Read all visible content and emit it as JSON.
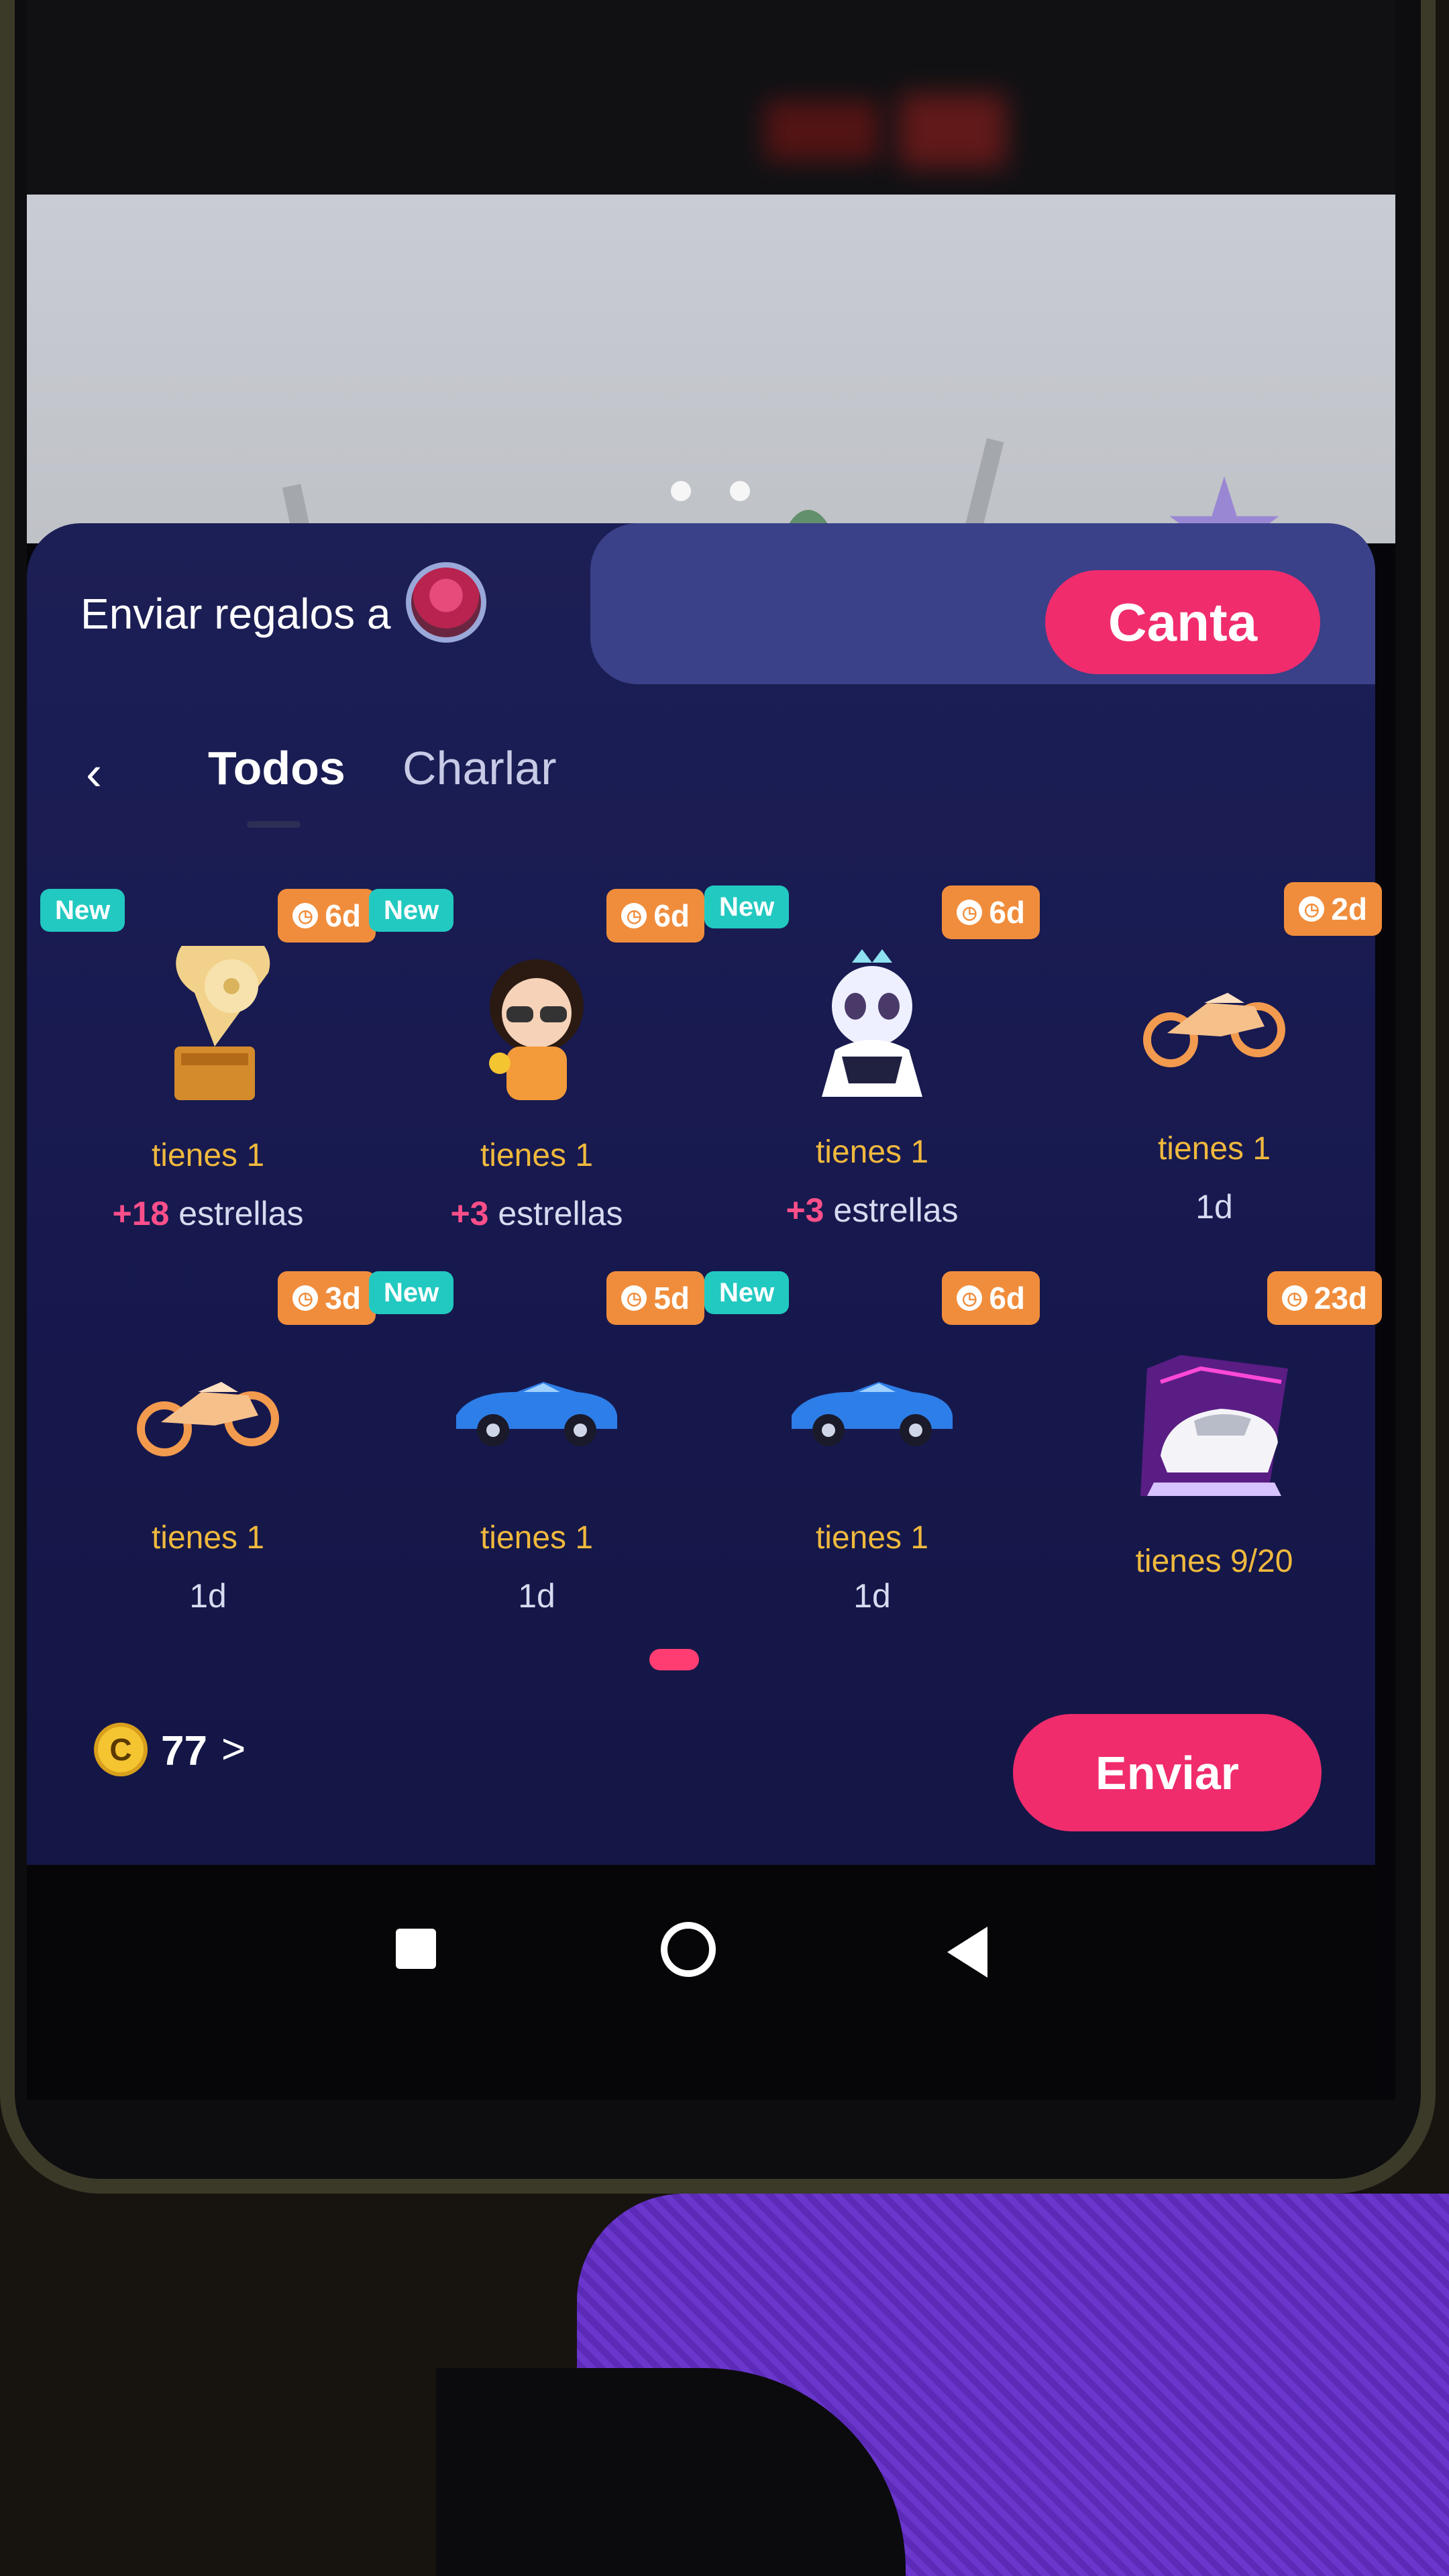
{
  "header": {
    "send_to_label": "Enviar regalos a",
    "canta_button": "Canta"
  },
  "tabs": [
    {
      "label": "Todos",
      "active": true
    },
    {
      "label": "Charlar",
      "active": false
    }
  ],
  "gifts": [
    {
      "name": "gramophone-gift",
      "new": true,
      "time": "6d",
      "owned": "tienes 1",
      "stars_value": "+18",
      "stars_text": " estrellas"
    },
    {
      "name": "girl-avatar-gift",
      "new": true,
      "time": "6d",
      "owned": "tienes 1",
      "stars_value": "+3",
      "stars_text": " estrellas"
    },
    {
      "name": "panda-princess-gift",
      "new": true,
      "time": "6d",
      "owned": "tienes 1",
      "stars_value": "+3",
      "stars_text": " estrellas"
    },
    {
      "name": "motorcycle-gift",
      "new": false,
      "time": "2d",
      "owned": "tienes 1",
      "duration": "1d"
    },
    {
      "name": "motorcycle-gift",
      "new": false,
      "time": "3d",
      "owned": "tienes 1",
      "duration": "1d"
    },
    {
      "name": "blue-car-gift",
      "new": true,
      "time": "5d",
      "owned": "tienes 1",
      "duration": "1d"
    },
    {
      "name": "blue-car-gift",
      "new": true,
      "time": "6d",
      "owned": "tienes 1",
      "duration": "1d"
    },
    {
      "name": "white-sports-car-gift",
      "new": false,
      "time": "23d",
      "owned": "tienes 9/20"
    }
  ],
  "new_label": "New",
  "wallet": {
    "coin_symbol": "C",
    "coins": "77",
    "chevron": ">"
  },
  "send_button": "Enviar",
  "colors": {
    "accent": "#f02c6d",
    "badge_time": "#f08d3c",
    "badge_new": "#22c9c0",
    "panel": "#1c1f55"
  }
}
